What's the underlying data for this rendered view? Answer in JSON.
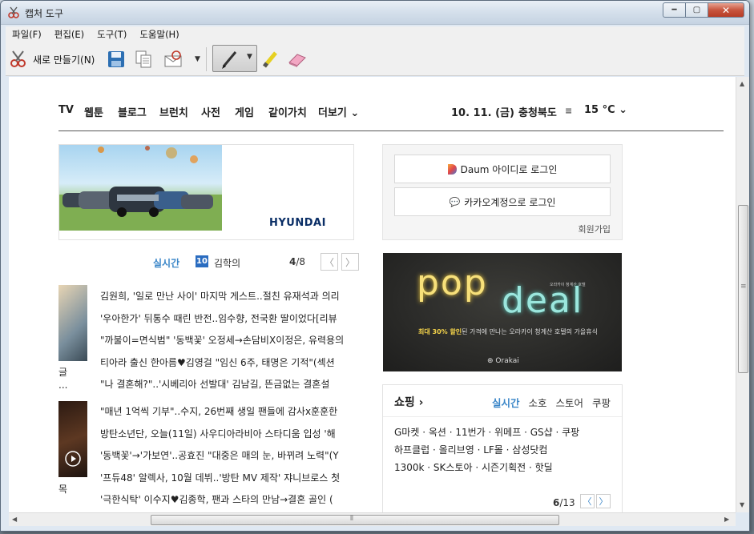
{
  "window": {
    "title": "캡처 도구",
    "controls": {
      "minimize": "▭",
      "maximize": "□",
      "close": "✕"
    }
  },
  "menu": [
    "파일(F)",
    "편집(E)",
    "도구(T)",
    "도움말(H)"
  ],
  "toolbar": {
    "new_label": "새로 만들기(N)",
    "icons": [
      "scissors-icon",
      "save-icon",
      "copy-icon",
      "send-email-icon",
      "dropdown-arrow-icon",
      "pen-icon",
      "highlighter-icon",
      "eraser-icon"
    ]
  },
  "web": {
    "nav": [
      "TV",
      "웹툰",
      "블로그",
      "브런치",
      "사전",
      "게임",
      "같이가치",
      "더보기 ⌄"
    ],
    "date": "10. 11. (금)",
    "region": "충청북도",
    "temp": "15 °C ⌄",
    "ad_brand": "HYUNDAI",
    "realtime": {
      "label": "실시간",
      "rank": "10",
      "keyword": "김학의",
      "page_current": "4",
      "page_total": "/8",
      "prev": "〈",
      "next": "〉"
    },
    "news_group1": [
      "김원희, '일로 만난 사이' 마지막 게스트..절친 유재석과 의리",
      "'우아한가' 뒤통수 때린 반전..임수향, 전국환 딸이었다[리뷰",
      "\"까불이=면식범\" '동백꽃' 오정세→손담비X이정은, 유력용의",
      "티아라 출신 한아름♥김영걸 \"임신 6주, 태명은 기적\"(섹션",
      "\"나 결혼해?\"..'시베리아 선발대' 김남길, 뜬금없는 결혼설"
    ],
    "news_group2": [
      "\"매년 1억씩 기부\"..수지, 26번째 생일 팬들에 감사x훈훈한",
      "방탄소년단, 오늘(11일) 사우디아라비아 스타디움 입성 '해",
      "'동백꽃'→'가보연'..공효진 \"대중은 매의 눈, 바뀌려 노력\"(Y",
      "'프듀48' 알렉사, 10월 데뷔..'방탄 MV 제작' 쟈니브로스 첫",
      "'극한식탁' 이수지♥김종학, 팬과 스타의 만남→결혼 골인 ("
    ],
    "thumb_caption1": "글",
    "thumb_caption1b": "...",
    "thumb_caption2": "목",
    "login": {
      "daum": "Daum 아이디로 로그인",
      "kakao": "카카오계정으로 로그인",
      "signup": "회원가입"
    },
    "popdeal": {
      "word1": "pop",
      "word2": "deal",
      "small_top": "오라카이 청계산 호텔",
      "sub_highlight": "최대 30% 할인",
      "sub_rest": "된 가격에 만나는 오라카이 청계산 호텔의 가을휴식",
      "brand": "Orakai"
    },
    "shopping": {
      "title": "쇼핑 ›",
      "tabs": [
        "실시간",
        "소호",
        "스토어",
        "쿠팡"
      ],
      "line1": "G마켓 · 옥션 · 11번가 · 위메프 · GS샵 · 쿠팡",
      "line2": "하프클럽 · 올리브영 · LF몰 · 삼성닷컴",
      "line3": "1300k · SK스토아 · 시즌기획전 · 핫딜",
      "page_current": "6",
      "page_total": "/13",
      "prev": "〈",
      "next": "〉"
    }
  },
  "colors": {
    "accent_blue": "#3a86c8",
    "popdeal_yellow": "#f7e07a",
    "popdeal_cyan": "#9be6dd",
    "close_red": "#c8553e"
  }
}
